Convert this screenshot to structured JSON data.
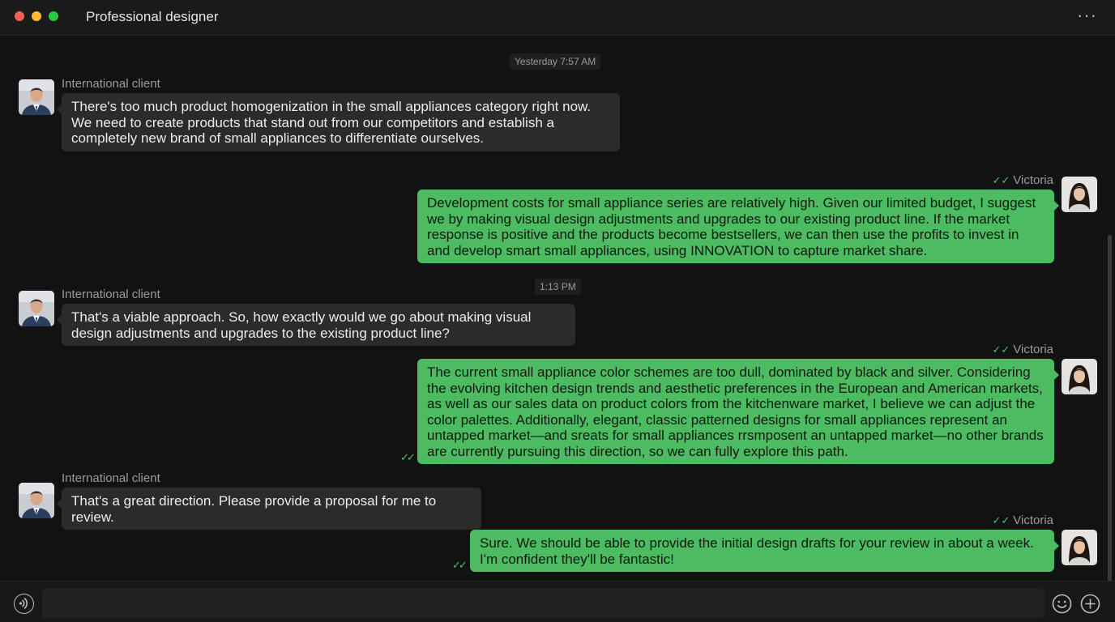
{
  "window": {
    "title": "Professional designer",
    "more_label": "···"
  },
  "timestamps": [
    "Yesterday 7:57 AM",
    "1:13 PM"
  ],
  "contact_name": "International client",
  "me_name": "Victoria",
  "messages": [
    {
      "from": "client",
      "text": "There's too much product homogenization in the small appliances category right now. We need to create products that stand out from our competitors and establish a completely new brand of small appliances to differentiate ourselves."
    },
    {
      "from": "me",
      "text": "Development costs for small appliance series are relatively high. Given our limited budget, I suggest we by making visual design adjustments and upgrades to our existing product line. If the market response is positive and the products become bestsellers, we can then use the profits to invest in and develop smart small appliances, using INNOVATION to capture market share."
    },
    {
      "from": "client",
      "text": "That's a viable approach. So, how exactly would we go about making visual design adjustments and upgrades to the existing product line?"
    },
    {
      "from": "me",
      "text": "The current small appliance color schemes are too dull, dominated by black and silver. Considering the evolving kitchen design trends and aesthetic preferences in the European and American markets, as well as our sales data on product colors from the kitchenware market, I believe we can adjust the color palettes. Additionally, elegant, classic patterned designs for small appliances represent an untapped market—and sreats for small appliances rrsmposent an untapped market—no other brands are currently pursuing this direction, so we can fully explore this path."
    },
    {
      "from": "client",
      "text": "That's a great direction. Please provide a proposal for me to review."
    },
    {
      "from": "me",
      "text": "Sure. We should be able to provide the initial design drafts for your review in about a week. I'm confident they'll be fantastic!"
    }
  ],
  "read_mark": "✓✓",
  "composer": {
    "placeholder": ""
  },
  "colors": {
    "background": "#121212",
    "incoming_bubble": "#2b2b2b",
    "outgoing_bubble": "#4cbb61",
    "read_check": "#4cc264"
  },
  "icons": [
    "more-icon",
    "voice-icon",
    "emoji-icon",
    "plus-icon",
    "checkmark-icon"
  ]
}
